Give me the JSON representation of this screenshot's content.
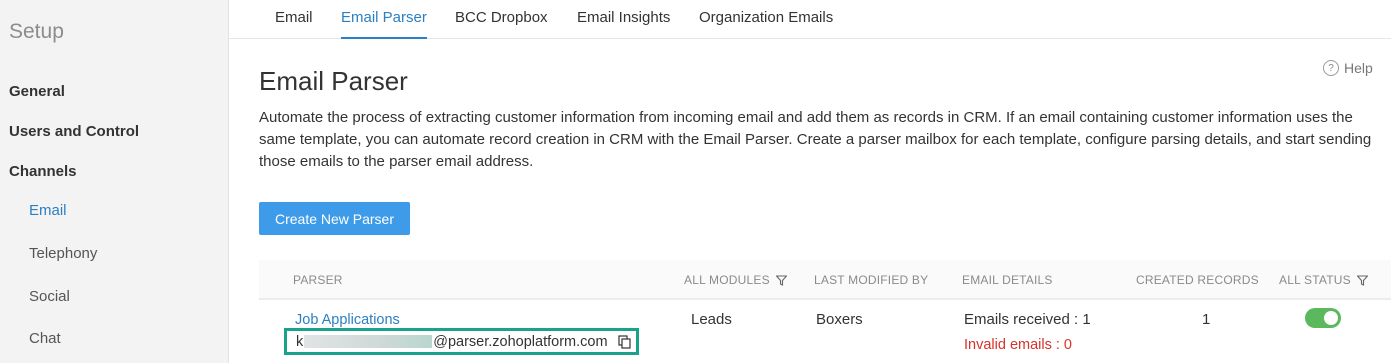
{
  "sidebar": {
    "title": "Setup",
    "sections": [
      {
        "label": "General"
      },
      {
        "label": "Users and Control"
      },
      {
        "label": "Channels"
      }
    ],
    "sub_items": [
      {
        "label": "Email",
        "active": true
      },
      {
        "label": "Telephony"
      },
      {
        "label": "Social"
      },
      {
        "label": "Chat"
      }
    ]
  },
  "tabs": [
    {
      "label": "Email"
    },
    {
      "label": "Email Parser",
      "active": true
    },
    {
      "label": "BCC Dropbox"
    },
    {
      "label": "Email Insights"
    },
    {
      "label": "Organization Emails"
    }
  ],
  "page": {
    "title": "Email Parser",
    "help_label": "Help",
    "help_icon": "?",
    "description": "Automate the process of extracting customer information from incoming email and add them as records in CRM. If an email containing customer information uses the same template, you can automate record creation in CRM with the Email Parser. Create a parser mailbox for each template, configure parsing details, and start sending those emails to the parser email address.",
    "create_button": "Create New Parser"
  },
  "table": {
    "columns": [
      {
        "label": "PARSER"
      },
      {
        "label": "ALL MODULES",
        "filter": true
      },
      {
        "label": "LAST MODIFIED BY"
      },
      {
        "label": "EMAIL DETAILS"
      },
      {
        "label": "CREATED RECORDS"
      },
      {
        "label": "ALL STATUS",
        "filter": true
      }
    ],
    "rows": [
      {
        "parser_name": "Job Applications",
        "email_prefix": "k",
        "email_suffix": "@parser.zohoplatform.com",
        "module": "Leads",
        "modified_by": "Boxers",
        "emails_received": "Emails received : 1",
        "invalid_emails": "Invalid emails : 0",
        "created_records": "1",
        "status_on": true
      }
    ]
  },
  "colors": {
    "accent": "#2b7fc3",
    "button": "#3d9be9",
    "highlight_border": "#1aa28c",
    "error": "#d9312b",
    "toggle_on": "#5cb85c"
  }
}
